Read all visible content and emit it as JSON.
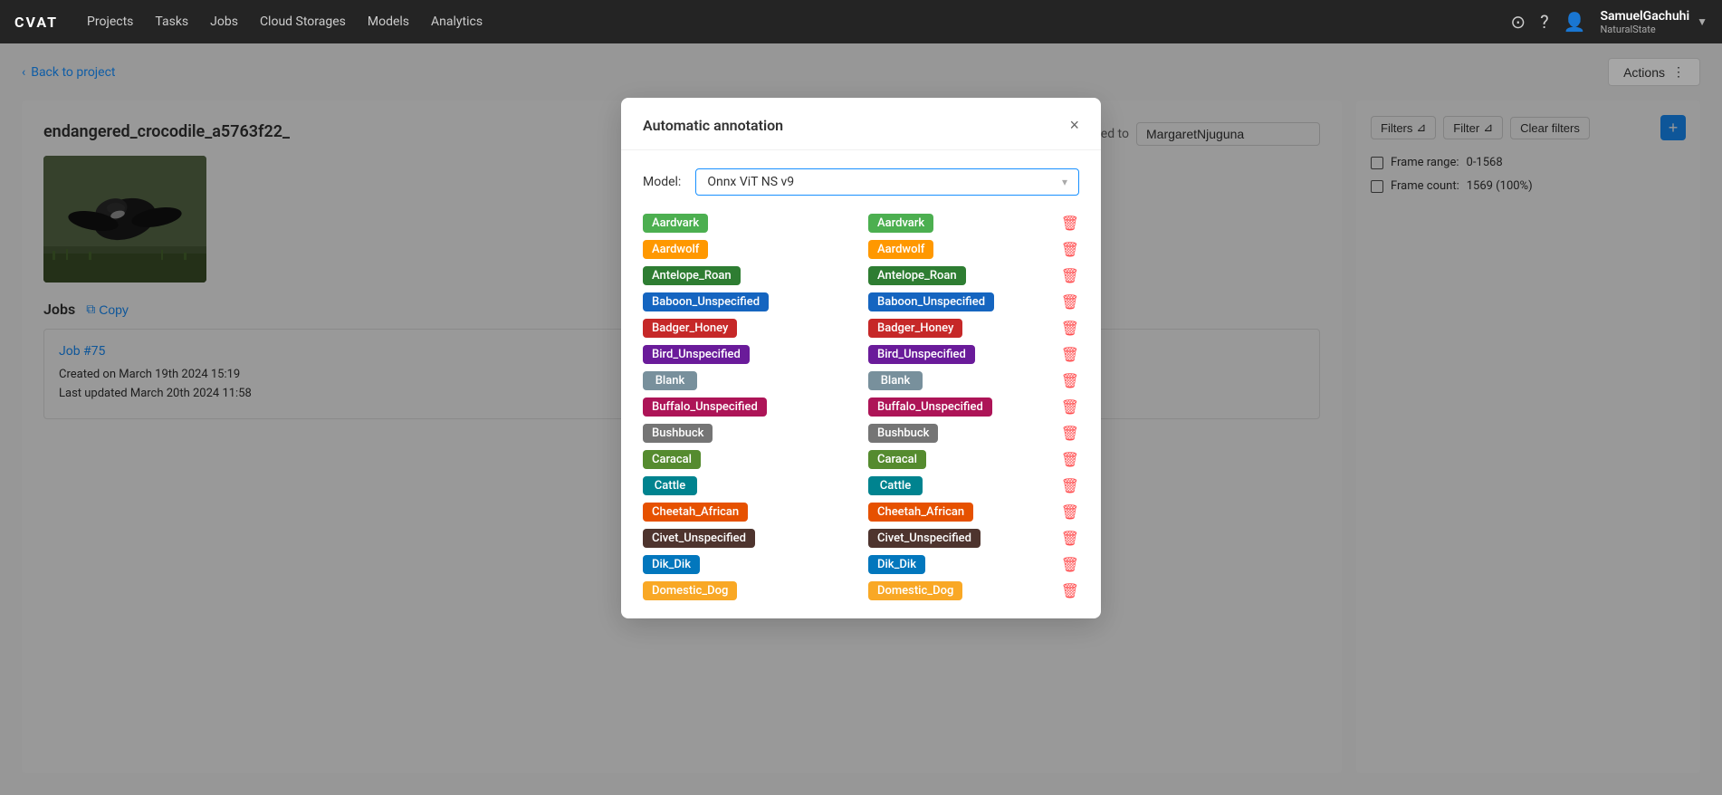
{
  "app": {
    "logo": "CVAT",
    "nav_links": [
      "Projects",
      "Tasks",
      "Jobs",
      "Cloud Storages",
      "Models",
      "Analytics"
    ]
  },
  "user": {
    "name": "SamuelGachuhi",
    "org": "NaturalState"
  },
  "breadcrumb": {
    "back_label": "Back to project"
  },
  "actions_button": "Actions",
  "task": {
    "title": "endangered_crocodile_a5763f22_",
    "assigned_label": "Assigned to",
    "assigned_value": "MargaretNjuguna"
  },
  "jobs_section": {
    "title": "Jobs",
    "copy_label": "Copy",
    "job": {
      "id": "Job #75",
      "created_label": "Created on",
      "created_value": "March 19th 2024 15:19",
      "updated_label": "Last updated",
      "updated_value": "March 20th 2024 11:58"
    }
  },
  "right_panel": {
    "filter_buttons": [
      "Filters",
      "Filter",
      "Clear filters"
    ],
    "add_label": "+",
    "frame_range_label": "Frame range:",
    "frame_range_value": "0-1568",
    "frame_count_label": "Frame count:",
    "frame_count_value": "1569 (100%)"
  },
  "modal": {
    "title": "Automatic annotation",
    "model_label": "Model:",
    "model_value": "Onnx ViT NS v9",
    "close_label": "×",
    "left_labels": [
      {
        "text": "Aardvark",
        "color": "#4caf50"
      },
      {
        "text": "Aardwolf",
        "color": "#ff9800"
      },
      {
        "text": "Antelope_Roan",
        "color": "#2e7d32"
      },
      {
        "text": "Baboon_Unspecified",
        "color": "#1565c0"
      },
      {
        "text": "Badger_Honey",
        "color": "#c62828"
      },
      {
        "text": "Bird_Unspecified",
        "color": "#6a1b9a"
      },
      {
        "text": "Blank",
        "color": "#78909c"
      },
      {
        "text": "Buffalo_Unspecified",
        "color": "#ad1457"
      },
      {
        "text": "Bushbuck",
        "color": "#757575"
      },
      {
        "text": "Caracal",
        "color": "#558b2f"
      },
      {
        "text": "Cattle",
        "color": "#00838f"
      },
      {
        "text": "Cheetah_African",
        "color": "#e65100"
      },
      {
        "text": "Civet_Unspecified",
        "color": "#4e342e"
      },
      {
        "text": "Dik_Dik",
        "color": "#0277bd"
      },
      {
        "text": "Domestic_Dog",
        "color": "#f9a825"
      }
    ],
    "right_labels": [
      {
        "text": "Aardvark",
        "color": "#4caf50"
      },
      {
        "text": "Aardwolf",
        "color": "#ff9800"
      },
      {
        "text": "Antelope_Roan",
        "color": "#2e7d32"
      },
      {
        "text": "Baboon_Unspecified",
        "color": "#1565c0"
      },
      {
        "text": "Badger_Honey",
        "color": "#c62828"
      },
      {
        "text": "Bird_Unspecified",
        "color": "#6a1b9a"
      },
      {
        "text": "Blank",
        "color": "#78909c"
      },
      {
        "text": "Buffalo_Unspecified",
        "color": "#ad1457"
      },
      {
        "text": "Bushbuck",
        "color": "#757575"
      },
      {
        "text": "Caracal",
        "color": "#558b2f"
      },
      {
        "text": "Cattle",
        "color": "#00838f"
      },
      {
        "text": "Cheetah_African",
        "color": "#e65100"
      },
      {
        "text": "Civet_Unspecified",
        "color": "#4e342e"
      },
      {
        "text": "Dik_Dik",
        "color": "#0277bd"
      },
      {
        "text": "Domestic_Dog",
        "color": "#f9a825"
      }
    ]
  }
}
